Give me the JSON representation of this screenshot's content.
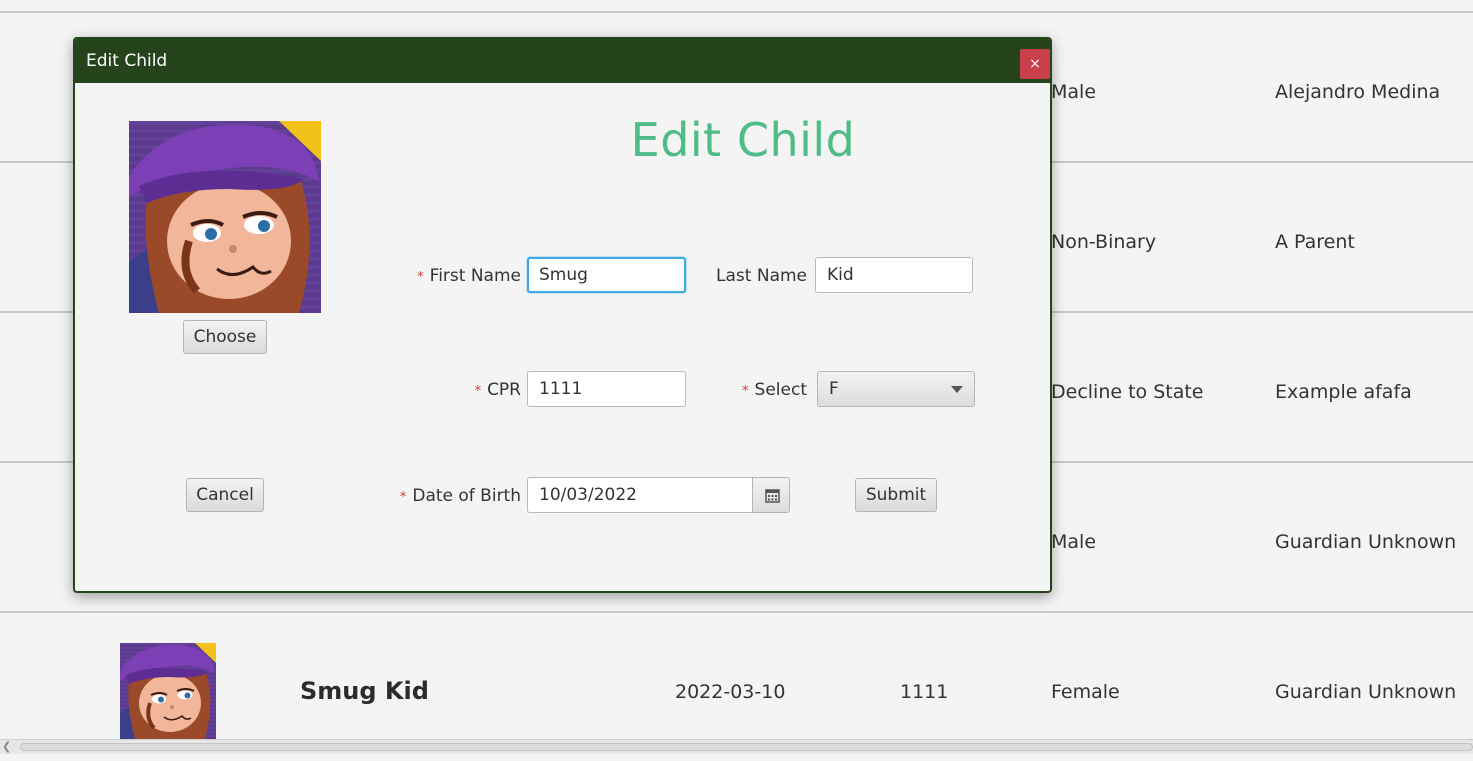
{
  "table": {
    "rows": [
      {
        "gender": "Male",
        "guardian": "Alejandro Medina"
      },
      {
        "gender": "Non-Binary",
        "guardian": "A Parent"
      },
      {
        "gender": "Decline to State",
        "guardian": "Example afafa"
      },
      {
        "gender": "Male",
        "guardian": "Guardian Unknown"
      },
      {
        "name": "Smug Kid",
        "dob": "2022-03-10",
        "cpr": "1111",
        "gender": "Female",
        "guardian": "Guardian Unknown"
      }
    ]
  },
  "dialog": {
    "window_title": "Edit Child",
    "close_label": "×",
    "heading": "Edit Child",
    "choose_label": "Choose",
    "cancel_label": "Cancel",
    "submit_label": "Submit",
    "required_marker": "*",
    "first_name": {
      "label": "First Name",
      "value": "Smug"
    },
    "last_name": {
      "label": "Last Name",
      "value": "Kid"
    },
    "cpr": {
      "label": "CPR",
      "value": "1111"
    },
    "gender_select": {
      "label": "Select",
      "value": "F"
    },
    "dob": {
      "label": "Date of Birth",
      "value": "10/03/2022"
    }
  },
  "icons": {
    "close": "close-icon",
    "calendar": "calendar-icon",
    "dropdown": "chevron-down-icon",
    "scroll_left": "scroll-left-icon"
  },
  "colors": {
    "titlebar": "#25441c",
    "heading": "#4fbc88",
    "close": "#c9404b",
    "required": "#d93b3b",
    "focus": "#3fa8dc"
  }
}
